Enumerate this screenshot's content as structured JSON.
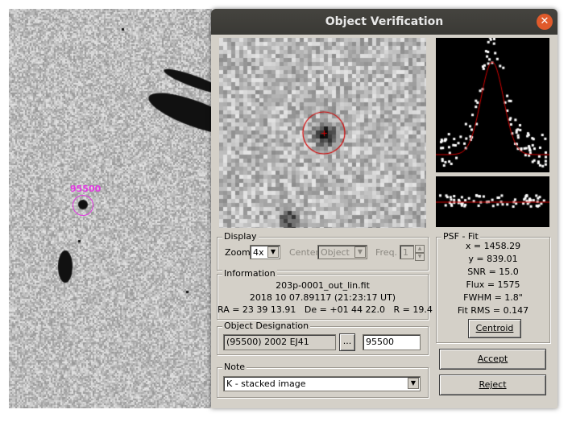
{
  "window": {
    "title": "Object Verification"
  },
  "background_image": {
    "object_label": "95500"
  },
  "display": {
    "group_title": "Display",
    "zoom_label": "Zoom",
    "zoom_value": "4x",
    "center_label": "Center",
    "center_value": "Object",
    "freq_label": "Freq.",
    "freq_value": "1"
  },
  "information": {
    "group_title": "Information",
    "filename": "203p-0001_out_lin.fit",
    "datetime": "2018 10 07.89117 (21:23:17 UT)",
    "coords": "RA = 23 39 13.91   De = +01 44 22.0   R = 19.4"
  },
  "designation": {
    "group_title": "Object Designation",
    "name": "(95500) 2002 EJ41",
    "browse": "...",
    "number": "95500"
  },
  "note": {
    "group_title": "Note",
    "value": "K - stacked image"
  },
  "psf": {
    "group_title": "PSF - Fit",
    "lines": [
      "x = 1458.29",
      "y = 839.01",
      "SNR = 15.0",
      "Flux = 1575",
      "FWHM = 1.8\"",
      "Fit RMS = 0.147"
    ],
    "centroid_button": "Centroid"
  },
  "buttons": {
    "accept": "Accept",
    "reject": "Reject"
  },
  "colors": {
    "titlebar": "#3c3b37",
    "close": "#e05a2b",
    "label_magenta": "#e23ae2",
    "fit_curve": "#d40000"
  }
}
